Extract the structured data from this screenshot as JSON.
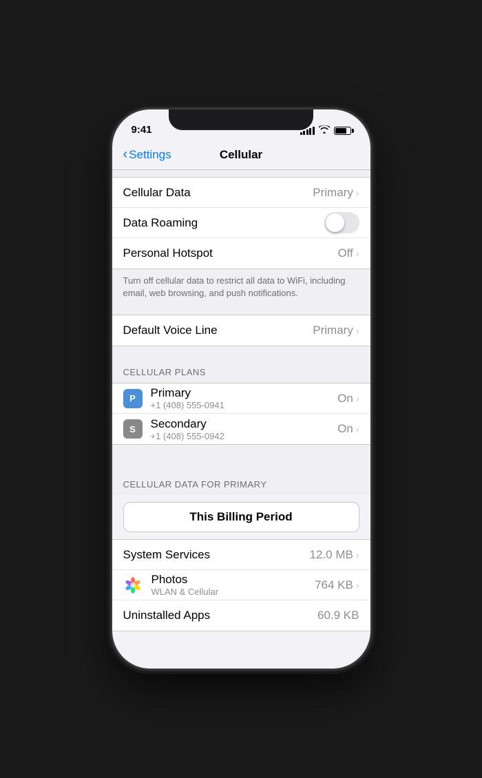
{
  "status": {
    "time": "9:41",
    "signal_bars": [
      4,
      6,
      8,
      10,
      12
    ],
    "battery_level": 80
  },
  "nav": {
    "back_label": "Settings",
    "title": "Cellular"
  },
  "rows": {
    "cellular_data": {
      "label": "Cellular Data",
      "value": "Primary"
    },
    "data_roaming": {
      "label": "Data Roaming",
      "toggle": false
    },
    "personal_hotspot": {
      "label": "Personal Hotspot",
      "value": "Off"
    },
    "description": "Turn off cellular data to restrict all data to WiFi, including email, web browsing, and push notifications.",
    "default_voice_line": {
      "label": "Default Voice Line",
      "value": "Primary"
    },
    "cellular_plans_header": "CELLULAR PLANS",
    "primary_plan": {
      "label": "Primary",
      "number": "+1 (408) 555-0941",
      "value": "On",
      "icon": "P"
    },
    "secondary_plan": {
      "label": "Secondary",
      "number": "+1 (408) 555-0942",
      "value": "On",
      "icon": "S"
    },
    "cellular_data_primary_header": "CELLULAR DATA FOR PRIMARY",
    "billing_period_btn": "This Billing Period",
    "system_services": {
      "label": "System Services",
      "value": "12.0 MB"
    },
    "photos": {
      "label": "Photos",
      "sublabel": "WLAN & Cellular",
      "value": "764 KB"
    },
    "uninstalled_apps": {
      "label": "Uninstalled Apps",
      "value": "60.9 KB"
    }
  }
}
